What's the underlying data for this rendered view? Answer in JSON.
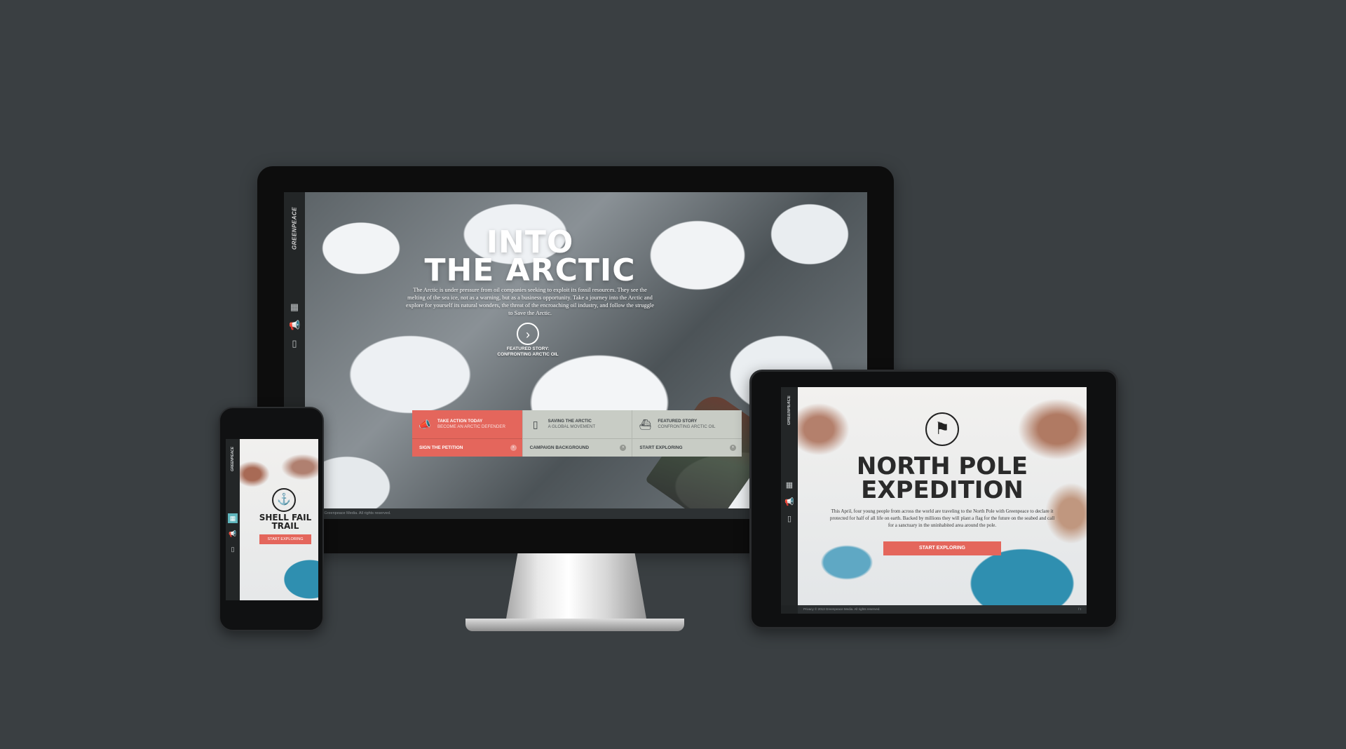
{
  "desktop": {
    "logo": "GREENPEACE",
    "hero_title_line1": "INTO",
    "hero_title_line2": "THE ARCTIC",
    "hero_copy": "The Arctic is under pressure from oil companies seeking to exploit its fossil resources. They see the melting of the sea ice, not as a warning, but as a business opportunity. Take a journey into the Arctic and explore for yourself its natural wonders, the threat of the encroaching oil industry, and follow the struggle to Save the Arctic.",
    "featured_label": "FEATURED STORY:",
    "featured_title": "CONFRONTING ARCTIC OIL",
    "cards": [
      {
        "title": "TAKE ACTION TODAY",
        "subtitle": "BECOME AN ARCTIC DEFENDER",
        "link": "SIGN THE PETITION",
        "icon": "megaphone-icon"
      },
      {
        "title": "SAVING THE ARCTIC",
        "subtitle": "A GLOBAL MOVEMENT",
        "link": "CAMPAIGN BACKGROUND",
        "icon": "book-icon"
      },
      {
        "title": "FEATURED STORY",
        "subtitle": "CONFRONTING ARCTIC OIL",
        "link": "START EXPLORING",
        "icon": "ship-badge-icon"
      }
    ],
    "footer": "© 2013 Greenpeace Media. All rights reserved.",
    "nav_icons": [
      "map-icon",
      "megaphone-icon",
      "book-icon"
    ]
  },
  "phone": {
    "logo": "GREENPEACE",
    "title_line1": "SHELL FAIL",
    "title_line2": "TRAIL",
    "button": "START EXPLORING"
  },
  "tablet": {
    "logo": "GREENPEACE",
    "title_line1": "NORTH POLE",
    "title_line2": "EXPEDITION",
    "copy": "This April, four young people from across the world are traveling to the North Pole with Greenpeace to declare it protected for half of all life on earth. Backed by millions they will plant a flag for the future on the seabed and call for a sanctuary in the uninhabited area around the pole.",
    "button": "START EXPLORING",
    "footer_left": "Privacy   © 2013 Greenpeace Media. All rights reserved.",
    "footer_right": "f  t"
  },
  "colors": {
    "background": "#3a3f42",
    "accent": "#e4665c",
    "card_grey": "#c8ccc5",
    "active_nav": "#5fb6bd"
  }
}
